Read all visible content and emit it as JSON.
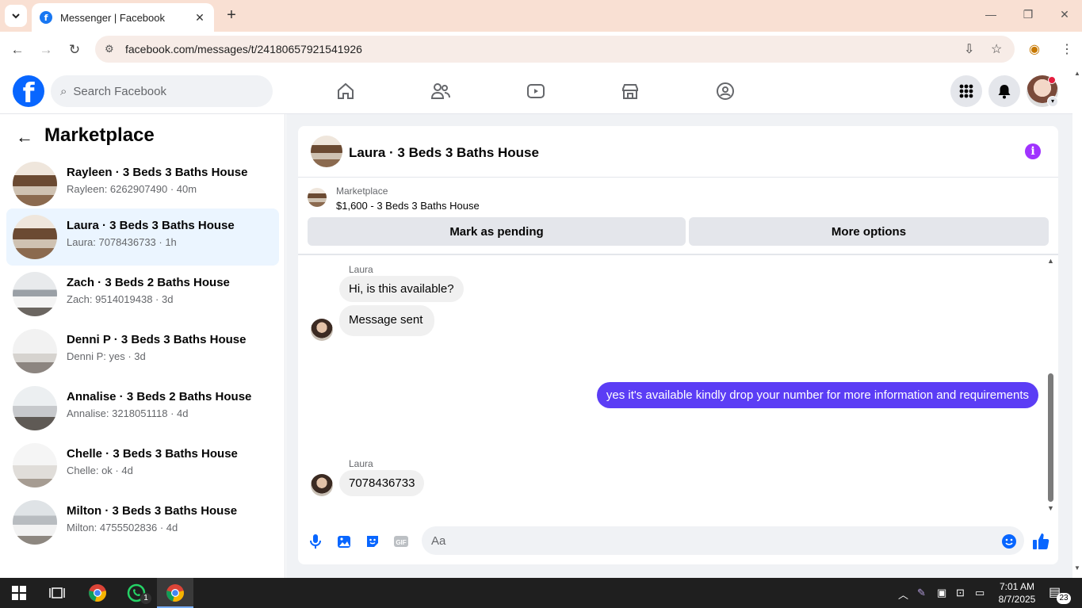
{
  "browser": {
    "tab_title": "Messenger | Facebook",
    "url": "facebook.com/messages/t/24180657921541926"
  },
  "facebook": {
    "search_placeholder": "Search Facebook"
  },
  "marketplace": {
    "title": "Marketplace",
    "conversations": [
      {
        "name": "Rayleen · 3 Beds 3 Baths House",
        "preview": "Rayleen: 6262907490 · 40m"
      },
      {
        "name": "Laura · 3 Beds 3 Baths House",
        "preview": "Laura: 7078436733 · 1h"
      },
      {
        "name": "Zach · 3 Beds 2 Baths House",
        "preview": "Zach: 9514019438 · 3d"
      },
      {
        "name": "Denni P · 3 Beds 3 Baths House",
        "preview": "Denni P: yes · 3d"
      },
      {
        "name": "Annalise · 3 Beds 2 Baths House",
        "preview": "Annalise: 3218051118 · 4d"
      },
      {
        "name": "Chelle · 3 Beds 3 Baths House",
        "preview": "Chelle: ok · 4d"
      },
      {
        "name": "Milton · 3 Beds 3 Baths House",
        "preview": "Milton: 4755502836 · 4d"
      }
    ]
  },
  "chat": {
    "title": "Laura · 3 Beds 3 Baths House",
    "listing_label": "Marketplace",
    "listing": "$1,600 - 3 Beds 3 Baths House",
    "mark_pending": "Mark as pending",
    "more_options": "More options",
    "messages": [
      {
        "sender": "Laura",
        "text": "Hi, is this available?"
      },
      {
        "text": "Message sent"
      },
      {
        "text": "yes it's available kindly drop your number for more information and requirements"
      },
      {
        "sender": "Laura",
        "text": "7078436733"
      }
    ],
    "input_placeholder": "Aa"
  },
  "taskbar": {
    "time": "7:01 AM",
    "date": "8/7/2025",
    "whatsapp_badge": "1",
    "notification_count": "23"
  },
  "colors": {
    "facebook_blue": "#0866ff",
    "outgoing_bubble": "#5b3df5",
    "info_purple": "#a033ff",
    "active_row": "#ebf5ff"
  }
}
